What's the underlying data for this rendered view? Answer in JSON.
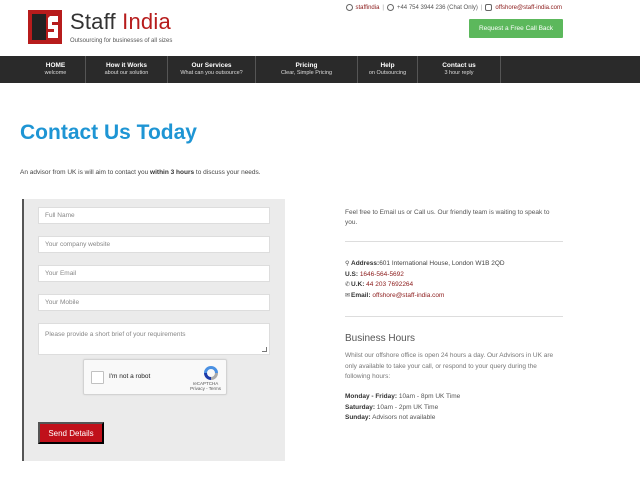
{
  "header": {
    "logo_name": "Staff",
    "logo_accent": "India",
    "tagline": "Outsourcing for businesses of all sizes",
    "skype": "staffindia",
    "phone": "+44 754 3944 236 (Chat Only)",
    "email": "offshore@staff-india.com",
    "callback_label": "Request a Free Call Back"
  },
  "nav": [
    {
      "title": "HOME",
      "sub": "welcome"
    },
    {
      "title": "How it Works",
      "sub": "about our solution"
    },
    {
      "title": "Our Services",
      "sub": "What can you outsource?"
    },
    {
      "title": "Pricing",
      "sub": "Clear, Simple Pricing"
    },
    {
      "title": "Help",
      "sub": "on Outsourcing"
    },
    {
      "title": "Contact us",
      "sub": "3 hour reply"
    }
  ],
  "main": {
    "title": "Contact Us Today",
    "intro_pre": "An advisor from UK is will aim to contact you ",
    "intro_bold": "within 3 hours",
    "intro_post": " to discuss your needs."
  },
  "form": {
    "full_name_placeholder": "Full Name",
    "website_placeholder": "Your company website",
    "email_placeholder": "Your Email",
    "mobile_placeholder": "Your Mobile",
    "brief_placeholder": "Please provide a short brief of your requirements",
    "captcha_label": "I'm not a robot",
    "captcha_brand": "reCAPTCHA",
    "captcha_links": "Privacy - Terms",
    "send_label": "Send Details"
  },
  "contact": {
    "intro": "Feel free to Email us or Call us. Our friendly team is waiting to speak to you.",
    "address_label": "Address:",
    "address_value": "601 International House, London W1B 2QD",
    "us_label": "U.S:",
    "us_phone": "1646-564-5692",
    "uk_label": "U.K:",
    "uk_phone": "44 203 7692264",
    "email_label": "Email:",
    "email_value": "offshore@staff-india.com"
  },
  "business_hours": {
    "title": "Business Hours",
    "text": "Whilst our offshore office is open 24 hours a day. Our Advisors in UK are only available to take your call, or respond to your query during the following hours:",
    "rows": [
      {
        "day": "Monday - Friday:",
        "hours": "10am - 8pm UK Time"
      },
      {
        "day": "Saturday:",
        "hours": "10am - 2pm UK Time"
      },
      {
        "day": "Sunday:",
        "hours": "Advisors not available"
      }
    ]
  },
  "colors": {
    "accent_blue": "#1e95d4",
    "brand_red": "#b71c1c",
    "button_red": "#c0101a",
    "callback_green": "#5cb85c",
    "nav_bg": "#2a2a2a"
  }
}
